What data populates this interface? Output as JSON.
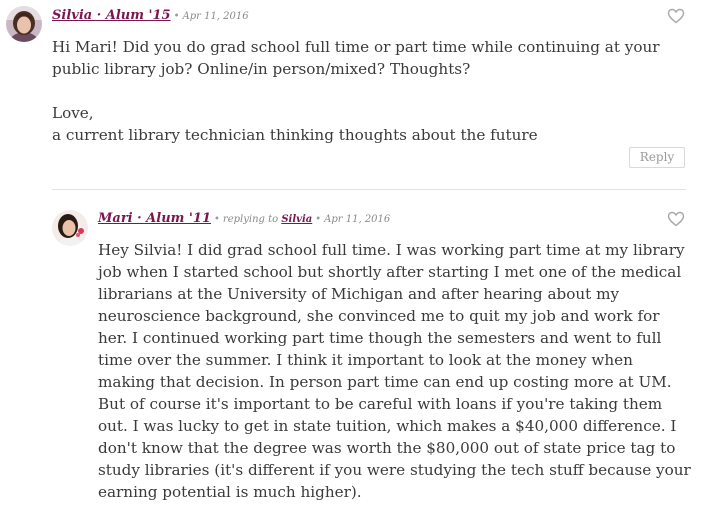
{
  "comments": [
    {
      "author": "Silvia · Alum '15",
      "date": "Apr 11, 2016",
      "paragraphs": [
        "Hi Mari! Did you do grad school full time or part time while continuing at your public library job? Online/in person/mixed? Thoughts?",
        "Love,",
        "a current library technician thinking thoughts about the future"
      ],
      "reply_label": "Reply"
    },
    {
      "author": "Mari · Alum '11",
      "replying_prefix": "replying to",
      "replying_to": "Silvia",
      "date": "Apr 11, 2016",
      "body": "Hey Silvia! I did grad school full time. I was working part time at my library job when I started school but shortly after starting I met one of the medical librarians at the University of Michigan and after hearing about my neuroscience background, she convinced me to quit my job and work for her. I continued working part time though the semesters and went to full time over the summer. I think it important to look at the money when making that decision. In person part time can end up costing more at UM. But of course it's important to be careful with loans if you're taking them out. I was lucky to get in state tuition, which makes a $40,000 difference. I don't know that the degree was worth the $80,000 out of state price tag to study libraries (it's different if you were studying the tech stuff because your earning potential is much higher)."
    }
  ],
  "colors": {
    "author_link": "#7b1550",
    "meta_text": "#8a8a8a",
    "body_text": "#3a3a3a",
    "divider": "#e3e3e3",
    "heart_outline": "#a8a8a8"
  },
  "icons": {
    "like": "heart-outline-icon",
    "avatar_1": "avatar-photo",
    "avatar_2": "avatar-photo"
  }
}
